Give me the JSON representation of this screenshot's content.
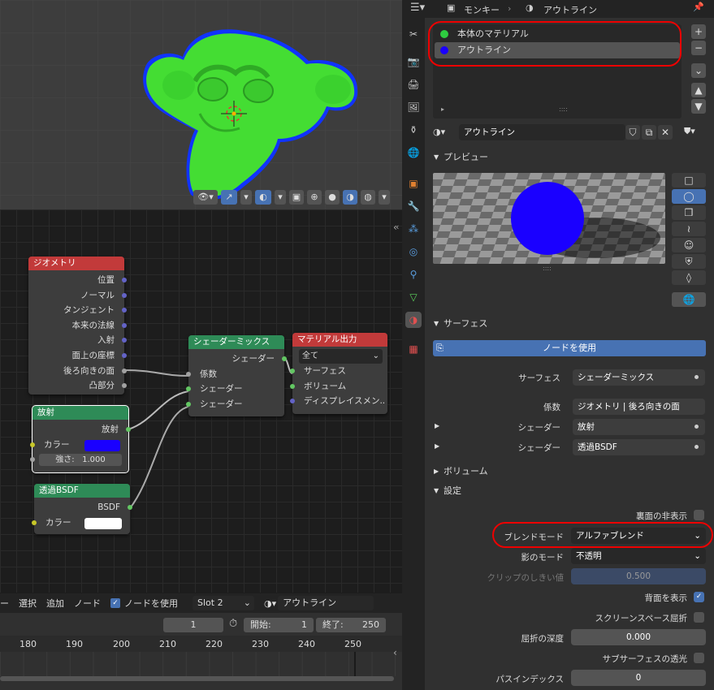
{
  "viewport": {
    "header_icons": [
      "eye-icon",
      "gizmo-icon",
      "overlay-icon",
      "xray-icon",
      "shading-wire",
      "shading-solid",
      "shading-material",
      "shading-rendered"
    ]
  },
  "node_editor": {
    "geometry": {
      "title": "ジオメトリ",
      "outputs": [
        "位置",
        "ノーマル",
        "タンジェント",
        "本来の法線",
        "入射",
        "面上の座標",
        "後ろ向きの面",
        "凸部分"
      ]
    },
    "emission": {
      "title": "放射",
      "output": "放射",
      "color_label": "カラー",
      "strength_label": "強さ:",
      "strength_value": "1.000",
      "color": "#1a00ff"
    },
    "transparent": {
      "title": "透過BSDF",
      "output": "BSDF",
      "color_label": "カラー"
    },
    "mix": {
      "title": "シェーダーミックス",
      "output": "シェーダー",
      "inputs": [
        "係数",
        "シェーダー",
        "シェーダー"
      ]
    },
    "output": {
      "title": "マテリアル出力",
      "target": "全て",
      "inputs": [
        "サーフェス",
        "ボリューム",
        "ディスプレイスメン.."
      ]
    },
    "header": {
      "items": [
        "ー",
        "選択",
        "追加",
        "ノード"
      ],
      "use_nodes": "ノードを使用",
      "slot": "Slot 2",
      "material": "アウトライン"
    }
  },
  "timeline": {
    "current_frame": "1",
    "start_label": "開始:",
    "start": "1",
    "end_label": "終了:",
    "end": "250",
    "ticks": [
      "180",
      "190",
      "200",
      "210",
      "220",
      "230",
      "240",
      "250"
    ]
  },
  "properties": {
    "header": {
      "object": "モンキー",
      "material": "アウトライン"
    },
    "material_slots": [
      {
        "name": "本体のマテリアル",
        "color": "#2ecc40"
      },
      {
        "name": "アウトライン",
        "color": "#1a00ff"
      }
    ],
    "material_name": "アウトライン",
    "preview_label": "プレビュー",
    "surface_label": "サーフェス",
    "use_nodes_button": "ノードを使用",
    "surface": {
      "surface_label": "サーフェス",
      "surface_value": "シェーダーミックス",
      "fac_label": "係数",
      "fac_value": "ジオメトリ | 後ろ向きの面",
      "shader1_label": "シェーダー",
      "shader1_value": "放射",
      "shader2_label": "シェーダー",
      "shader2_value": "透過BSDF"
    },
    "volume_label": "ボリューム",
    "settings_label": "設定",
    "settings": {
      "backface_culling": "裏面の非表示",
      "blend_mode_label": "ブレンドモード",
      "blend_mode": "アルファブレンド",
      "shadow_mode_label": "影のモード",
      "shadow_mode": "不透明",
      "clip_label": "クリップのしきい値",
      "clip_value": "0.500",
      "show_backface": "背面を表示",
      "ssr": "スクリーンスペース屈折",
      "refraction_depth_label": "屈折の深度",
      "refraction_depth": "0.000",
      "sss": "サブサーフェスの透光",
      "pass_index_label": "パスインデックス",
      "pass_index": "0"
    }
  }
}
